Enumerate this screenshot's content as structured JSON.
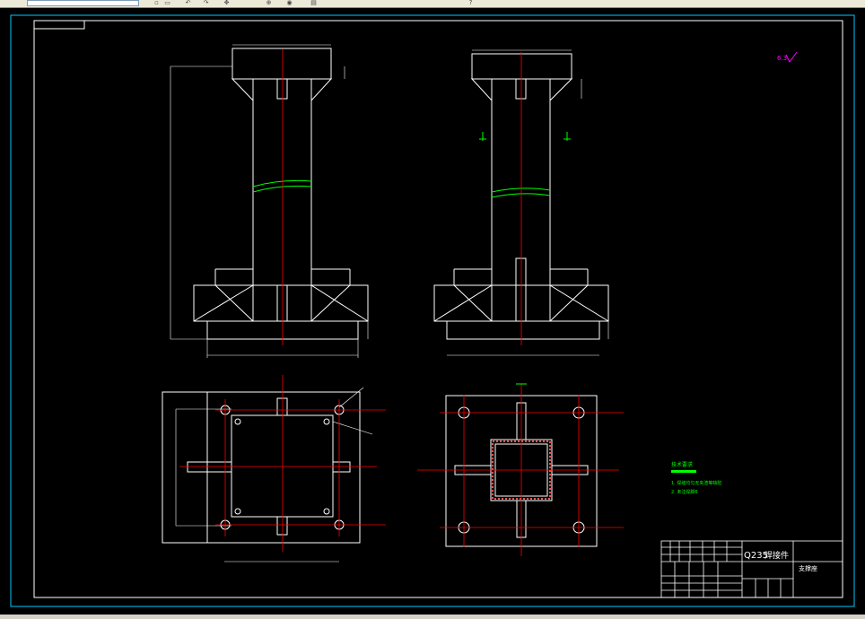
{
  "toolbar": {
    "buttons": [
      "new-icon",
      "open-icon",
      "undo-icon",
      "redo-icon",
      "pan-icon",
      "zoom-icon",
      "properties-icon",
      "layer-icon",
      "help-icon"
    ]
  },
  "drawing": {
    "colors": {
      "background": "#000000",
      "outline": "#ffffff",
      "centerline": "#ff0000",
      "dimension": "#ffffff",
      "break_line": "#00ff00",
      "tech_notes": "#00ff00",
      "roughness": "#ff00ff",
      "frame": "#ffffff"
    },
    "roughness_symbol": "6.3",
    "title_block": {
      "material": "Q235",
      "part_name": "焊接件",
      "drawing_name": "支撑座"
    },
    "tech_notes": {
      "heading": "技术要求",
      "lines": [
        "1. 焊缝均匀无夹渣等缺陷",
        "2. 未注焊脚6"
      ]
    }
  }
}
